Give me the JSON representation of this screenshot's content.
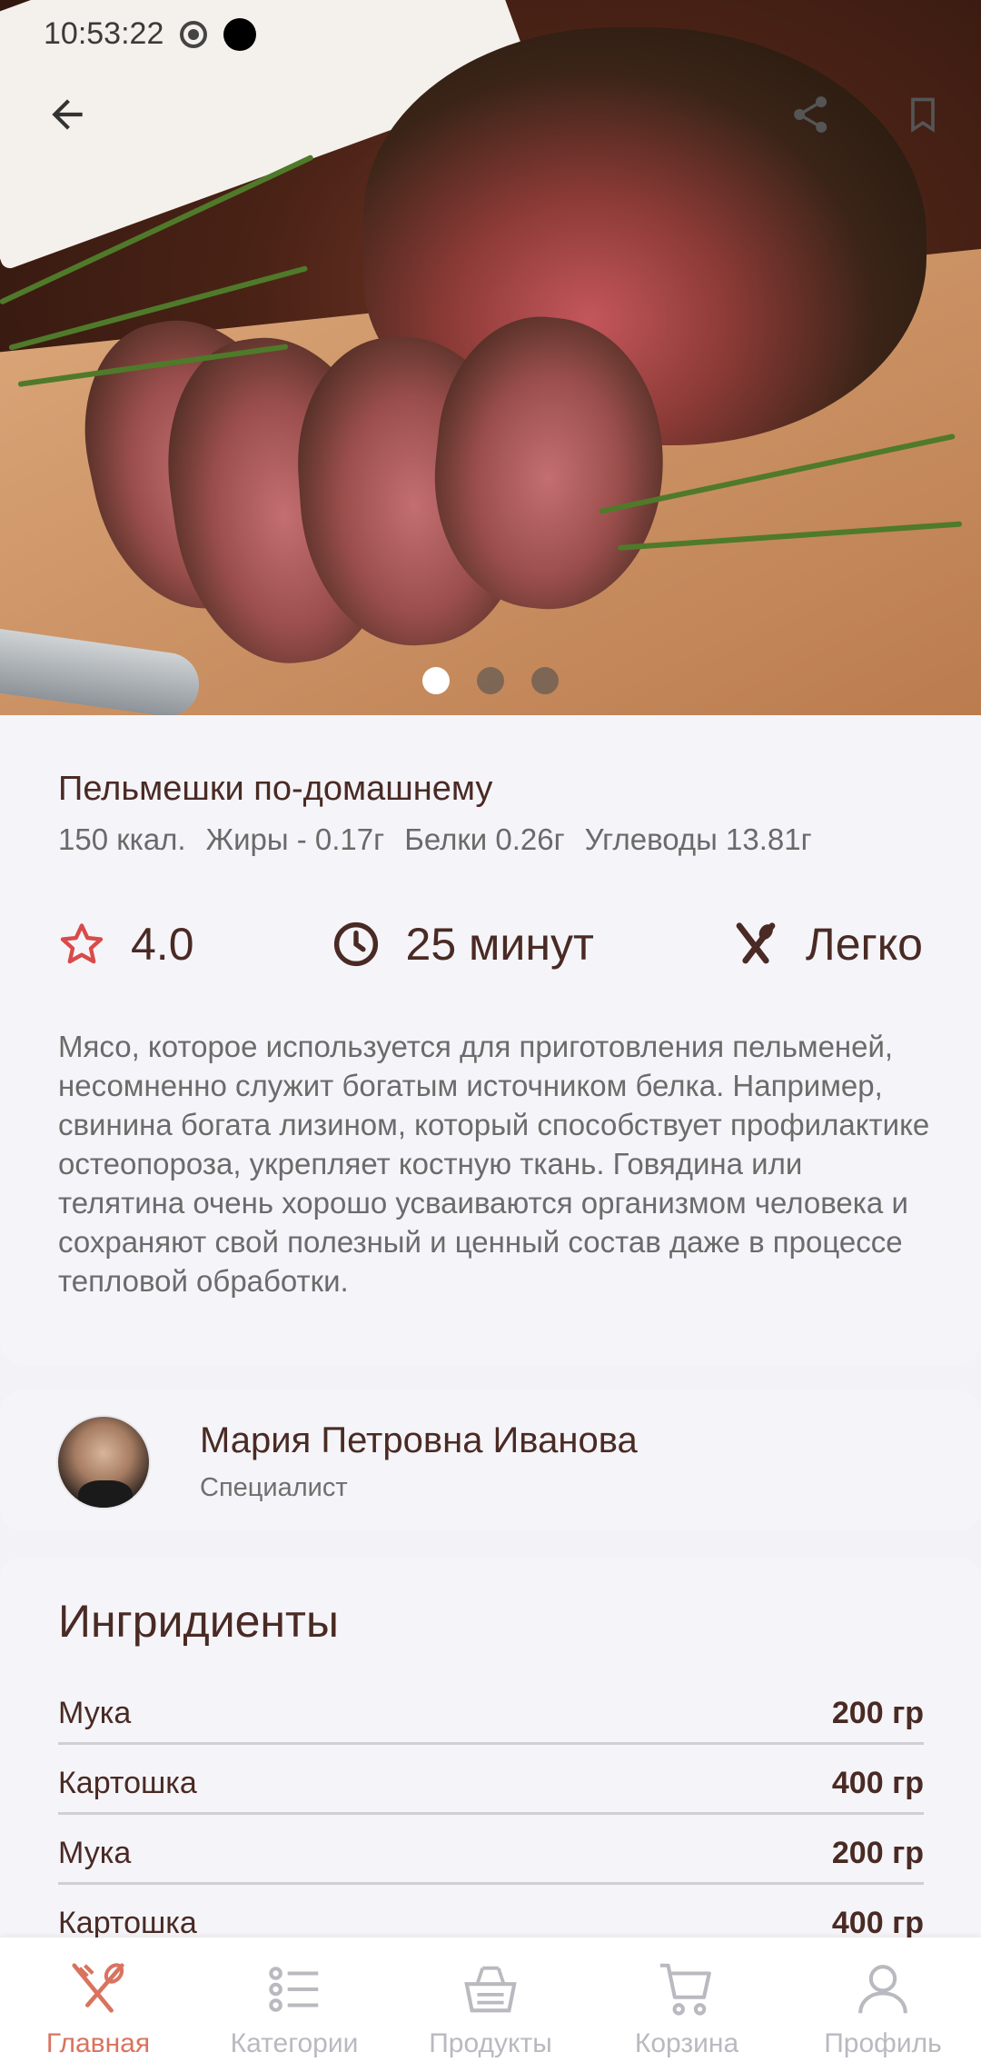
{
  "status_bar": {
    "time": "10:53:22"
  },
  "hero": {
    "image_alt": "Roast beef",
    "pages": 3,
    "active_page": 1
  },
  "recipe": {
    "title": "Пельмешки по-домашнему",
    "nutrition": [
      "150 ккал.",
      "Жиры - 0.17г",
      "Белки 0.26г",
      "Углеводы 13.81г"
    ],
    "rating": "4.0",
    "time": "25 минут",
    "difficulty": "Легко",
    "description": "Мясо, которое используется для приготовления пельменей, несомненно служит богатым источником белка. Например, свинина богата лизином, который способствует профилактике остеопороза, укрепляет костную ткань. Говядина или телятина очень хорошо усваиваются организмом человека и сохраняют свой полезный и ценный состав даже в процессе тепловой обработки."
  },
  "author": {
    "name": "Мария Петровна Иванова",
    "role": "Специалист"
  },
  "ingredients": {
    "title": "Ингридиенты",
    "items": [
      {
        "name": "Мука",
        "amount": "200 гр"
      },
      {
        "name": "Картошка",
        "amount": "400 гр"
      },
      {
        "name": "Мука",
        "amount": "200 гр"
      },
      {
        "name": "Картошка",
        "amount": "400 гр"
      }
    ]
  },
  "nav": {
    "items": [
      {
        "label": "Главная",
        "icon": "fork-knife-icon",
        "active": true
      },
      {
        "label": "Категории",
        "icon": "list-icon",
        "active": false
      },
      {
        "label": "Продукты",
        "icon": "basket-icon",
        "active": false
      },
      {
        "label": "Корзина",
        "icon": "cart-icon",
        "active": false
      },
      {
        "label": "Профиль",
        "icon": "profile-icon",
        "active": false
      }
    ]
  },
  "colors": {
    "accent": "#d9735f",
    "brown": "#4a2a24",
    "inactive": "#b9b9c0",
    "star": "#d94a4a"
  }
}
